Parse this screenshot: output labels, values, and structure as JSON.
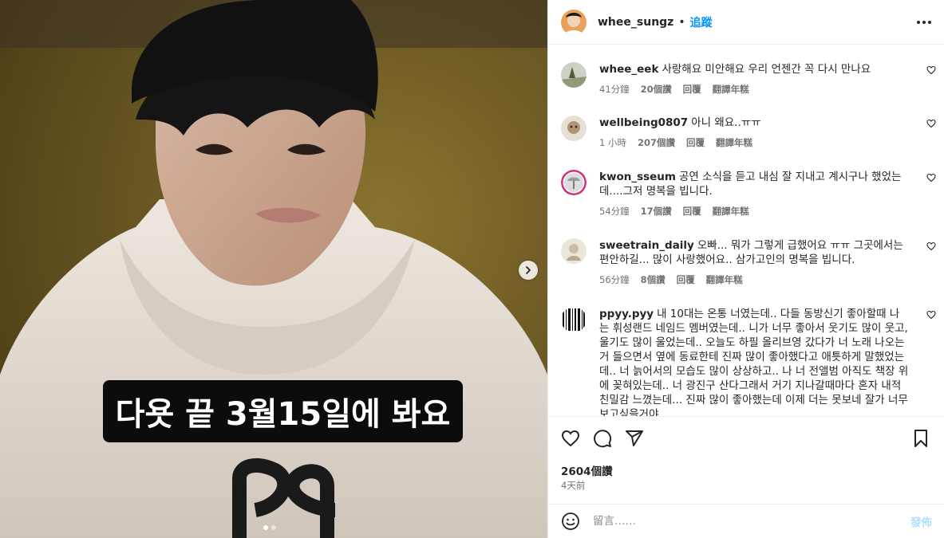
{
  "header": {
    "username": "whee_sungz",
    "separator": "•",
    "follow_label": "追蹤"
  },
  "media": {
    "caption": "다욧 끝 3월15일에 봐요",
    "slide_count": 2,
    "active_slide": 0
  },
  "comments": [
    {
      "username": "whee_eek",
      "text": "사랑해요 미안해요 우리 언젠간 꼭 다시 만나요",
      "time": "41分鐘",
      "likes": "20個讚",
      "reply": "回覆",
      "translate": "翻譯年糕"
    },
    {
      "username": "wellbeing0807",
      "text": "아니 왜요..ㅠㅠ",
      "time": "1 小時",
      "likes": "207個讚",
      "reply": "回覆",
      "translate": "翻譯年糕"
    },
    {
      "username": "kwon_sseum",
      "text": "공연 소식을 듣고 내심 잘 지내고 계시구나 했었는데....그저 명복을 빕니다.",
      "time": "54分鐘",
      "likes": "17個讚",
      "reply": "回覆",
      "translate": "翻譯年糕"
    },
    {
      "username": "sweetrain_daily",
      "text": "오빠... 뭐가 그렇게 급했어요 ㅠㅠ 그곳에서는 편안하길... 많이 사랑했어요.. 삼가고인의 명복을 빕니다.",
      "time": "56分鐘",
      "likes": "8個讚",
      "reply": "回覆",
      "translate": "翻譯年糕"
    },
    {
      "username": "ppyy.pyy",
      "text": "내 10대는 온통 너였는데.. 다들 동방신기 좋아할때 나는 휘성랜드 네임드 멤버였는데.. 니가 너무 좋아서 웃기도 많이 웃고, 울기도 많이 울었는데.. 오늘도 하필 올리브영 갔다가 너 노래 나오는거 들으면서 옆에 동료한테 진짜 많이 좋아했다고 애틋하게 말했었는데.. 너 늙어서의 모습도 많이 상상하고.. 나 너 전앨범 아직도 책장 위에 꽂혀있는데.. 너 광진구 산다그래서 거기 지나갈때마다 혼자 내적친밀감 느꼈는데... 진짜 많이 좋아했는데 이제 더는 못보네 잘가 너무 보고싶을거야",
      "time": "",
      "likes": "",
      "reply": "",
      "translate": ""
    }
  ],
  "actions": {
    "likes_count": "2604個讚",
    "posted_ago": "4天前"
  },
  "composer": {
    "placeholder": "留言……",
    "post_label": "發佈"
  }
}
